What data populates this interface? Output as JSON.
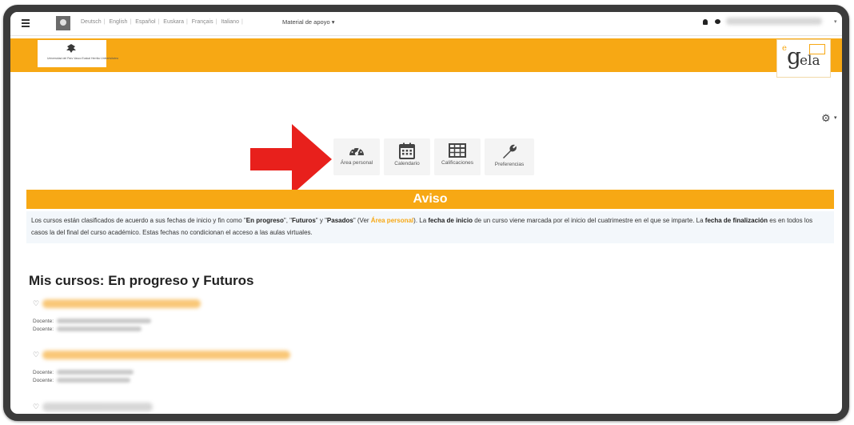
{
  "topbar": {
    "languages": [
      "Deutsch",
      "English",
      "Español",
      "Euskara",
      "Français",
      "Italiano"
    ],
    "separator": "|",
    "support_menu": "Material de apoyo ▾",
    "user_caret": "▾"
  },
  "header": {
    "ehu_logo_text": "Universidad del País Vasco  Euskal Herriko Unibertsitatea",
    "egela_logo_text": "egela"
  },
  "settings_caret": "▾",
  "quick_links": [
    {
      "label": "Área personal",
      "icon": "dashboard-icon"
    },
    {
      "label": "Calendario",
      "icon": "calendar-icon"
    },
    {
      "label": "Calificaciones",
      "icon": "grades-table-icon"
    },
    {
      "label": "Preferencias",
      "icon": "wrench-icon"
    }
  ],
  "notice": {
    "title": "Aviso",
    "p1": "Los cursos están clasificados de acuerdo a sus fechas de inicio y fin como \"",
    "b1": "En progreso",
    "p2": "\", \"",
    "b2": "Futuros",
    "p3": "\" y \"",
    "b3": "Pasados",
    "p4": "\" (Ver ",
    "link": "Área personal",
    "p5": "). La ",
    "b4": "fecha de inicio",
    "p6": " de un curso viene marcada por el inicio del cuatrimestre en el que se imparte. La ",
    "b5": "fecha de finalización",
    "p7": " es en todos los casos la del final del curso académico. Estas fechas no condicionan el acceso a las aulas virtuales."
  },
  "courses": {
    "title": "Mis cursos: En progreso y Futuros",
    "teacher_label": "Docente:"
  },
  "colors": {
    "accent": "#f7a814",
    "arrow": "#e8201c",
    "frame": "#3b3b3b"
  }
}
